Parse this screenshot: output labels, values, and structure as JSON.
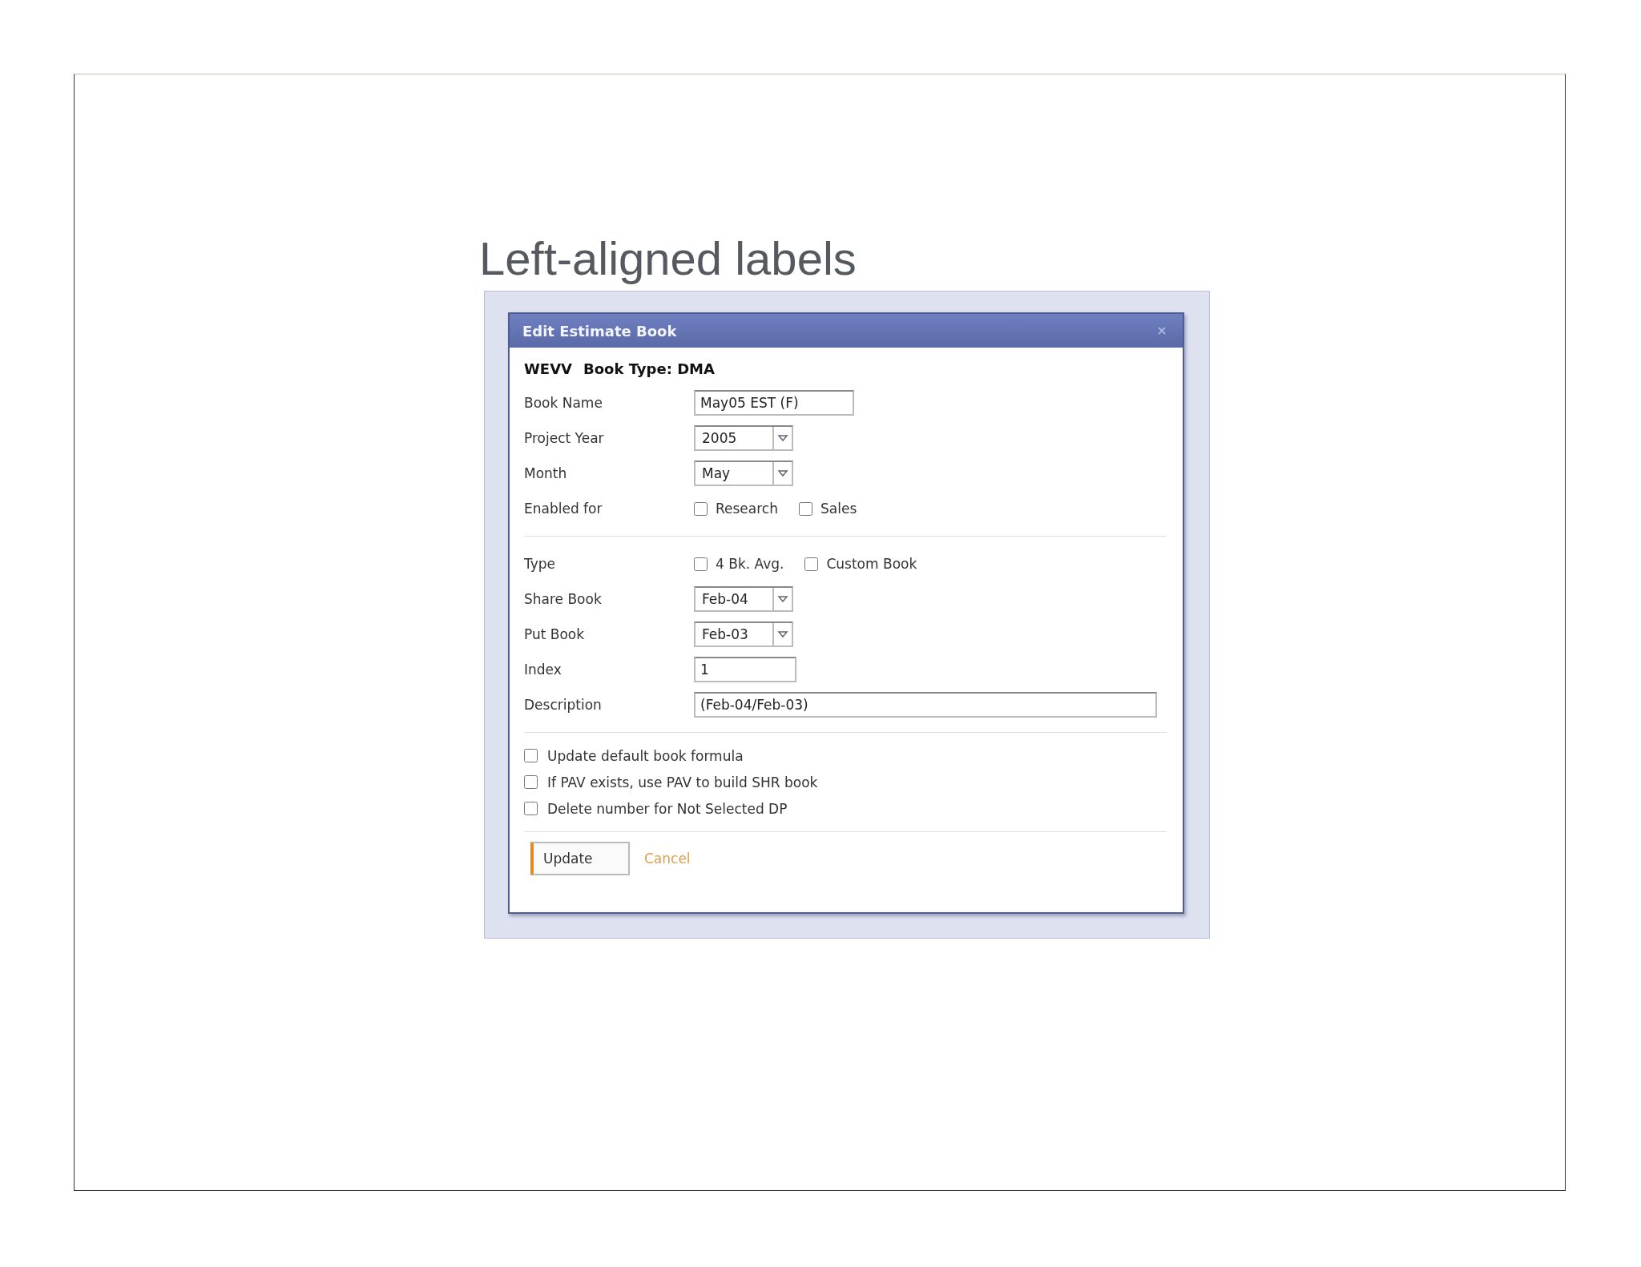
{
  "slide": {
    "title": "Left-aligned labels"
  },
  "dialog": {
    "title": "Edit Estimate Book",
    "heading": [
      "WEVV",
      "Book Type: DMA"
    ],
    "sections": [
      {
        "rows": [
          {
            "kind": "text",
            "label": "Book Name",
            "value": "May05 EST (F)"
          },
          {
            "kind": "select",
            "label": "Project Year",
            "value": "2005"
          },
          {
            "kind": "select",
            "label": "Month",
            "value": "May"
          },
          {
            "kind": "checks",
            "label": "Enabled for",
            "options": [
              {
                "label": "Research",
                "checked": false
              },
              {
                "label": "Sales",
                "checked": false
              }
            ]
          }
        ]
      },
      {
        "rows": [
          {
            "kind": "checks",
            "label": "Type",
            "options": [
              {
                "label": "4 Bk. Avg.",
                "checked": false
              },
              {
                "label": "Custom Book",
                "checked": false
              }
            ]
          },
          {
            "kind": "select",
            "label": "Share Book",
            "value": "Feb-04"
          },
          {
            "kind": "select",
            "label": "Put Book",
            "value": "Feb-03"
          },
          {
            "kind": "short_text",
            "label": "Index",
            "value": "1"
          },
          {
            "kind": "long_text",
            "label": "Description",
            "value": "(Feb-04/Feb-03)"
          }
        ]
      }
    ],
    "options": [
      {
        "label": "Update default book formula",
        "checked": false
      },
      {
        "label": "If PAV exists, use PAV to build SHR book",
        "checked": false
      },
      {
        "label": "Delete number for Not Selected DP",
        "checked": false
      }
    ],
    "buttons": [
      {
        "kind": "button",
        "label": "Update"
      },
      {
        "kind": "link",
        "label": "Cancel"
      }
    ]
  }
}
